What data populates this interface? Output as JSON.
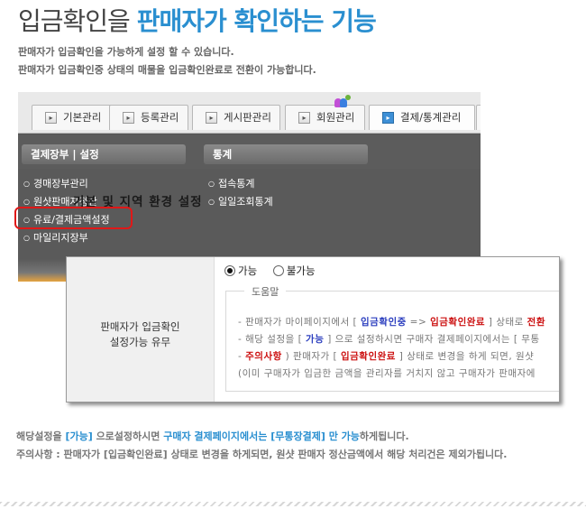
{
  "title": {
    "main": "입금확인을 ",
    "highlight": "판매자가 확인하는 기능"
  },
  "intro": [
    "판매자가 입금확인을 가능하게 설정 할 수 있습니다.",
    "판매자가 입금확인중 상태의 매물을 입금확인완료로 전환이 가능합니다."
  ],
  "admin_menu": {
    "tabs": [
      {
        "label": "기본관리",
        "icon": "page-icon"
      },
      {
        "label": "등록관리",
        "icon": "page-icon"
      },
      {
        "label": "게시판관리",
        "icon": "page-icon"
      },
      {
        "label": "회원관리",
        "icon": "page-icon"
      },
      {
        "label": "결제/통계관리",
        "icon": "page-icon"
      }
    ],
    "active_tab": "결제/통계관리",
    "sections": [
      {
        "heading": "결제장부 | 설정",
        "items": [
          "경매장부관리",
          "원샷판매자정산",
          "유료/결제금액설정",
          "마일리지장부"
        ]
      },
      {
        "heading": "통계",
        "items": [
          "접속통계",
          "일일조회통계"
        ]
      }
    ],
    "overlay_text": "기본 및 지역 환경 설정",
    "highlighted_item": "유료/결제금액설정"
  },
  "setting": {
    "label_line1": "판매자가 입금확인",
    "label_line2": "설정가능 유무",
    "options": [
      "가능",
      "불가능"
    ],
    "selected": "가능",
    "help_title": "도움말",
    "help": {
      "l1a": "- 판매자가 마이페이지에서 [ ",
      "l1b": "입금확인중",
      "l1c": " => ",
      "l1d": "입금확인완료",
      "l1e": " ] 상태로 ",
      "l1f": "전환",
      "l2a": "- 해당 설정을 [ ",
      "l2b": "가능",
      "l2c": " ] 으로 설정하시면 구매자 결제페이지에서는 [ 무통",
      "l3a": "- ",
      "l3b": "주의사항",
      "l3c": " ) 판매자가 [ ",
      "l3d": "입금확인완료",
      "l3e": " ] 상태로 변경을 하게 되면, 원샷",
      "l4": "(이미 구매자가 입금한 금액을 관리자를 거치지 않고 구매자가 판매자에"
    }
  },
  "notes": {
    "n1a": "해당설정을 ",
    "n1b": "[가능]",
    "n1c": " 으로설정하시면 ",
    "n1d": "구매자 결제페이지에서는 [무통장결제] 만 가능",
    "n1e": "하게됩니다.",
    "n2": "주의사항 : 판매자가 [입금확인완료] 상태로 변경을 하게되면, 원샷 판매자 정산금액에서 해당 처리건은 제외가됩니다."
  }
}
